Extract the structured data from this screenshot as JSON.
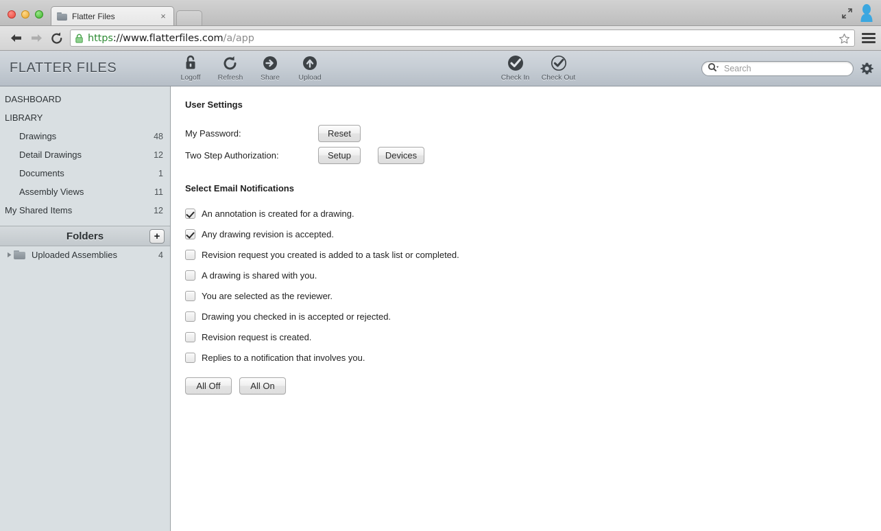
{
  "browser": {
    "tab": {
      "title": "Flatter Files",
      "favicon": "folder-icon",
      "close": "×"
    },
    "nav": {
      "back": "back-arrow-icon",
      "forward": "forward-arrow-icon",
      "reload": "reload-icon",
      "menu": "hamburger-menu-icon",
      "bookmark": "star-icon",
      "maximize": "maximize-icon",
      "profile": "user-avatar-icon"
    },
    "url": {
      "scheme": "https",
      "host": "://www.flatterfiles.com",
      "path": "/a/app",
      "lock": "lock-icon"
    }
  },
  "app": {
    "brand": "FLATTER FILES",
    "toolbar_left": [
      {
        "label": "Logoff",
        "icon": "unlock-icon"
      },
      {
        "label": "Refresh",
        "icon": "refresh-icon"
      },
      {
        "label": "Share",
        "icon": "share-arrow-icon"
      },
      {
        "label": "Upload",
        "icon": "upload-arrow-icon"
      }
    ],
    "toolbar_right": [
      {
        "label": "Check In",
        "icon": "check-in-icon"
      },
      {
        "label": "Check Out",
        "icon": "check-out-icon"
      }
    ],
    "search": {
      "placeholder": "Search",
      "value": "",
      "icon": "search-magnifier-icon"
    },
    "settings_icon": "gear-icon"
  },
  "sidebar": {
    "nav": [
      {
        "label": "DASHBOARD",
        "count": "",
        "sub": false
      },
      {
        "label": "LIBRARY",
        "count": "",
        "sub": false
      },
      {
        "label": "Drawings",
        "count": "48",
        "sub": true
      },
      {
        "label": "Detail Drawings",
        "count": "12",
        "sub": true
      },
      {
        "label": "Documents",
        "count": "1",
        "sub": true
      },
      {
        "label": "Assembly Views",
        "count": "11",
        "sub": true
      },
      {
        "label": "My Shared Items",
        "count": "12",
        "sub": false
      }
    ],
    "folders": {
      "title": "Folders",
      "add_label": "+",
      "items": [
        {
          "label": "Uploaded Assemblies",
          "count": "4",
          "disclosure": "▶"
        }
      ]
    }
  },
  "main": {
    "user_settings_title": "User Settings",
    "password_label": "My Password:",
    "password_button": "Reset",
    "twostep_label": "Two Step Authorization:",
    "twostep_setup_button": "Setup",
    "twostep_devices_button": "Devices",
    "notifications_title": "Select Email Notifications",
    "notifications": [
      {
        "label": "An annotation is created for a drawing.",
        "checked": true
      },
      {
        "label": "Any drawing revision is accepted.",
        "checked": true
      },
      {
        "label": "Revision request you created is added to a task list or completed.",
        "checked": false
      },
      {
        "label": "A drawing is shared with you.",
        "checked": false
      },
      {
        "label": "You are selected as the reviewer.",
        "checked": false
      },
      {
        "label": "Drawing you checked in is accepted or rejected.",
        "checked": false
      },
      {
        "label": "Revision request is created.",
        "checked": false
      },
      {
        "label": "Replies to a notification that involves you.",
        "checked": false
      }
    ],
    "all_off_button": "All Off",
    "all_on_button": "All On"
  },
  "colors": {
    "sidebar_bg": "#d9dfe2",
    "toolbar_top": "#d2d7dd",
    "toolbar_bottom": "#b6bec7",
    "url_scheme_green": "#2e8b34",
    "avatar_blue": "#3ba7e0"
  }
}
